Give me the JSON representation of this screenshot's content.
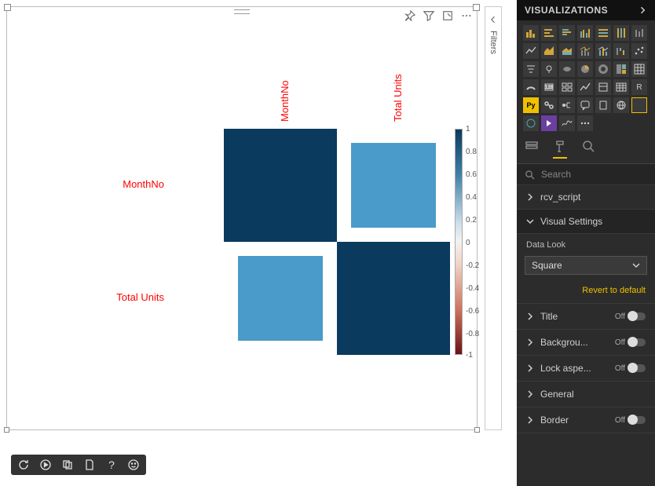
{
  "panel": {
    "title": "VISUALIZATIONS",
    "search_placeholder": "Search",
    "sections": {
      "rcv_script": "rcv_script",
      "visual_settings": "Visual Settings",
      "data_look_label": "Data Look",
      "data_look_value": "Square",
      "revert": "Revert to default",
      "title": "Title",
      "background": "Backgrou...",
      "lock_aspect": "Lock aspe...",
      "general": "General",
      "border": "Border",
      "off": "Off"
    }
  },
  "filters_label": "Filters",
  "chart_data": {
    "type": "heatmap",
    "title": "",
    "labels": [
      "MonthNo",
      "Total Units"
    ],
    "matrix": [
      [
        1.0,
        0.75
      ],
      [
        0.75,
        1.0
      ]
    ],
    "colorbar_ticks": [
      "1",
      "0.8",
      "0.6",
      "0.4",
      "0.2",
      "0",
      "-0.2",
      "-0.4",
      "-0.6",
      "-0.8",
      "-1"
    ],
    "colorbar_range": [
      -1,
      1
    ]
  }
}
